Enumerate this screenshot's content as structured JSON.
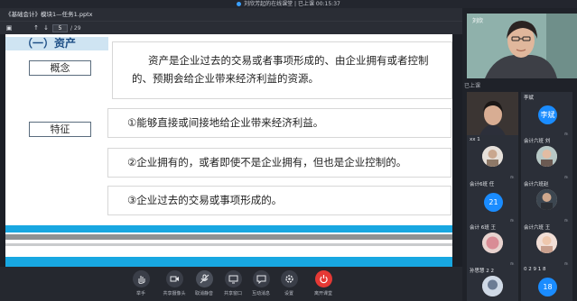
{
  "window": {
    "title": "刘欣芳起的在线课堂 | 已上课 00:15:37"
  },
  "file": {
    "title": "《基础会计》模块1—任务1.pptx"
  },
  "slidebar": {
    "current_page": "5",
    "total_pages": "/ 29"
  },
  "slide": {
    "heading": "（一）资产",
    "concept_label": "概念",
    "feature_label": "特征",
    "definition": "资产是企业过去的交易或者事项形成的、由企业拥有或者控制的、预期会给企业带来经济利益的资源。",
    "features": [
      "①能够直接或间接地给企业带来经济利益。",
      "②企业拥有的，或者即使不是企业拥有，但也是企业控制的。",
      "③企业过去的交易或事项形成的。"
    ]
  },
  "teacher": {
    "name": "刘欣"
  },
  "attendance": {
    "label": "已上课"
  },
  "students": [
    {
      "name": "李斌",
      "avatar": "李斌"
    },
    {
      "name": "会计六班 刘"
    },
    {
      "name": "xx 1"
    },
    {
      "name": "会计六班 王"
    },
    {
      "name": "会计6班 任"
    },
    {
      "name": "会计六班赵"
    },
    {
      "name": "会计 6班 王"
    },
    {
      "name": "会计六班 王"
    },
    {
      "name": "孙思慧 2 2"
    },
    {
      "name": "0 2 9 1 8"
    }
  ],
  "student_badges": {
    "t6": "21",
    "t10": "18"
  },
  "controls": [
    {
      "label": "举手",
      "icon": "hand-icon"
    },
    {
      "label": "共享摄像头",
      "icon": "camera-icon"
    },
    {
      "label": "取消静音",
      "icon": "mic-off-icon"
    },
    {
      "label": "共享窗口",
      "icon": "screen-share-icon"
    },
    {
      "label": "互动消息",
      "icon": "chat-icon"
    },
    {
      "label": "设置",
      "icon": "gear-icon"
    },
    {
      "label": "离开课堂",
      "icon": "power-icon"
    }
  ],
  "colors": {
    "slide_heading_bg": "#cfe4f2",
    "stripe_blue": "#18a7e1",
    "stripe_gray": "#8e9193",
    "avatar_blue": "#1a8cff",
    "leave_red": "#e53935"
  }
}
